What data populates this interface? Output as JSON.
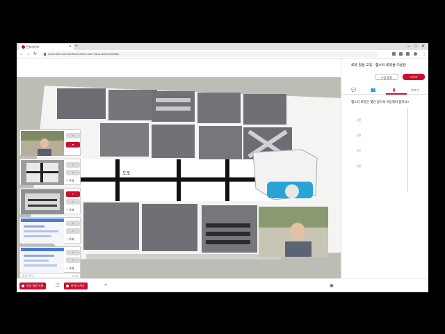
{
  "browser": {
    "tab_title": "몬티라이브",
    "new_tab": "+",
    "window_controls": [
      "–",
      "□",
      "✕"
    ],
    "url": "onthe.live/room/ab7f8c2d-5bee-4a27-9b1e-dd6374f29dbe"
  },
  "stage": {
    "road_label": "도로"
  },
  "tiles": [
    {
      "btn1": "○",
      "btn2": "●"
    },
    {
      "btn1": "○",
      "btn2": "○",
      "del": "─ 삭제"
    },
    {
      "btn1": "○",
      "btn2": "○",
      "del": "─ 삭제"
    },
    {
      "btn1": "○",
      "btn2": "○",
      "del": "─ 삭제"
    },
    {
      "btn1": "○",
      "btn2": "○",
      "del": "─ 삭제"
    }
  ],
  "tile_footer": {
    "placeholder": "참여 주석...",
    "count": "0 / 5"
  },
  "panel": {
    "title": "로봇 활용 교육 - 햄스터 로봇을 이용한",
    "edit_button": "수업 종료",
    "exit_button": "나가기",
    "tabs": [
      "💬",
      "👥",
      "▮",
      "더보기"
    ],
    "question": "햄스터 로봇은 몇칸 앞으로 이동해야 할까요?",
    "options": [
      "1칸",
      "2칸",
      "3칸",
      "4칸"
    ]
  },
  "bottom": {
    "record_button": "방송 영상 녹화",
    "mic_button": "마이크 켜기",
    "close_icon": "✕"
  },
  "colors": {
    "accent": "#c8102e"
  }
}
